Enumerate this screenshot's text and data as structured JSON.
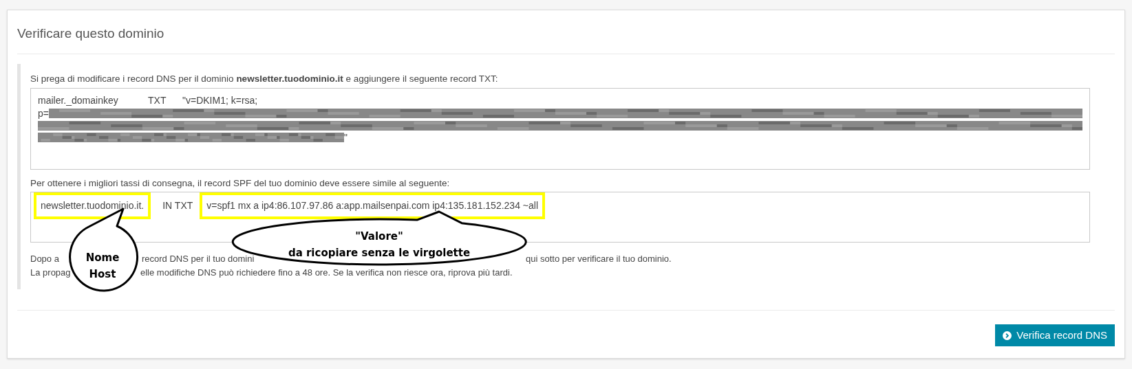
{
  "card": {
    "title": "Verificare questo dominio"
  },
  "dkim": {
    "intro": "Si prega di modificare i record DNS per il dominio **newsletter.tuodominio.it** e aggiungere il seguente record TXT:",
    "host": "mailer._domainkey",
    "type": "TXT",
    "value_start": "\"v=DKIM1; k=rsa;",
    "key_prefix": "p=",
    "value_end": "\""
  },
  "spf": {
    "intro": "Per ottenere i migliori tassi di consegna, il record SPF del tuo dominio deve essere simile al seguente:",
    "host": "newsletter.tuodominio.it.",
    "host_highlighted": true,
    "type": "IN TXT",
    "value": "v=spf1 mx a ip4:86.107.97.86 a:app.mailsenpai.com ip4:135.181.152.234 ~all",
    "value_highlighted": true
  },
  "notes": [
    [
      "Dopo a",
      "record DNS per il tuo domini",
      "qui sotto per verificare il tuo dominio."
    ],
    [
      "La propag",
      "elle modifiche DNS può richiedere fino a 48 ore. Se la verifica non riesce ora, riprova più tardi."
    ]
  ],
  "annotations": [
    {
      "kind": "circle",
      "lines": [
        "Nome",
        "Host"
      ]
    },
    {
      "kind": "ellipse",
      "lines": [
        "\"Valore\"",
        "da ricopiare senza le virgolette"
      ]
    }
  ],
  "button": {
    "label": "Verifica record DNS"
  }
}
